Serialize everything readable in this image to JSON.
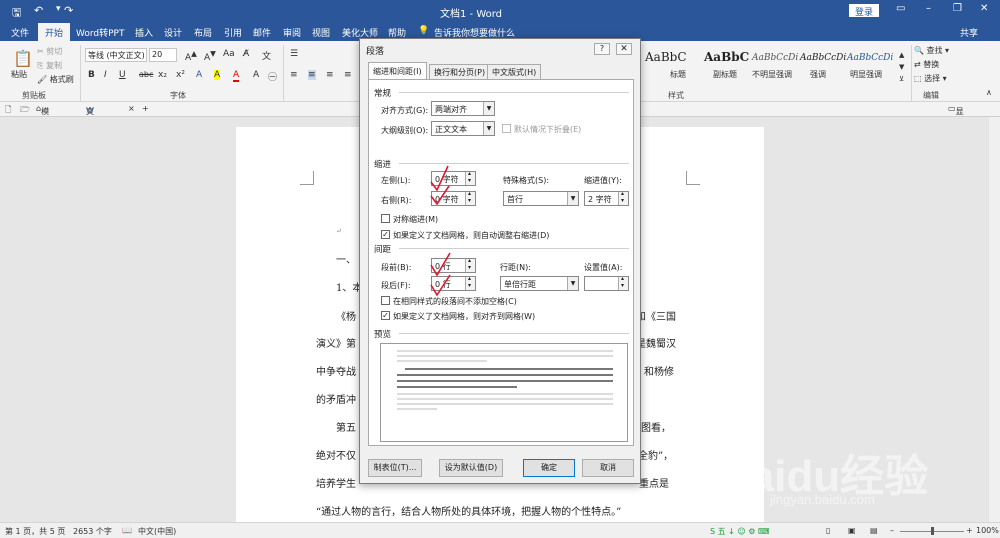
{
  "titlebar": {
    "title": "文档1 - Word",
    "login": "登录",
    "quick_access": [
      "save-icon",
      "undo-icon",
      "redo-icon",
      "customize-icon"
    ]
  },
  "tabs": [
    {
      "label": "文件"
    },
    {
      "label": "开始"
    },
    {
      "label": "Word转PPT"
    },
    {
      "label": "插入"
    },
    {
      "label": "设计"
    },
    {
      "label": "布局"
    },
    {
      "label": "引用"
    },
    {
      "label": "邮件"
    },
    {
      "label": "审阅"
    },
    {
      "label": "视图"
    },
    {
      "label": "美化大师"
    },
    {
      "label": "帮助"
    },
    {
      "label": "告诉我你想要做什么"
    }
  ],
  "share": "共享",
  "ribbon": {
    "clipboard": {
      "paste": "粘贴",
      "cut": "剪切",
      "copy": "复制",
      "format_painter": "格式刷",
      "label": "剪贴板"
    },
    "font": {
      "name": "等线 (中文正文)",
      "size": "20",
      "label": "字体",
      "buttons": [
        "B",
        "I",
        "U",
        "abc",
        "x₂",
        "x²",
        "A",
        "A",
        "A"
      ]
    },
    "styles": {
      "samples": [
        {
          "sample": "AaBbC",
          "name": "标题"
        },
        {
          "sample": "AaBbC",
          "name": "副标题"
        },
        {
          "sample": "AaBbCcDi",
          "name": "不明显强调"
        },
        {
          "sample": "AaBbCcDi",
          "name": "强调"
        },
        {
          "sample": "AaBbCcDi",
          "name": "明显强调"
        }
      ],
      "label": "样式"
    },
    "editing": {
      "find": "查找",
      "replace": "替换",
      "select": "选择",
      "label": "编辑"
    }
  },
  "doc_tabs": {
    "template": "模板专区",
    "doc": "文档1",
    "show_multi": "显示多窗口"
  },
  "document": {
    "lines": [
      "一、",
      "1、本",
      "《杨",
      "演义》第",
      "中争夺战",
      "的矛盾冲",
      "第五",
      "绝对不仅",
      "培养学生",
      "“通过人物的言行，结合人物所处的具体环境，把握人物的个性特点。”"
    ],
    "right_fragments": [
      "和《三国",
      "是魏蜀汉",
      "和杨修",
      "精意图看，",
      "周全豹”，",
      "重点是"
    ]
  },
  "dialog": {
    "title": "段落",
    "tabs": [
      "缩进和间距(I)",
      "换行和分页(P)",
      "中文版式(H)"
    ],
    "general": {
      "heading": "常规",
      "alignment_label": "对齐方式(G):",
      "alignment_value": "两端对齐",
      "outline_label": "大纲级别(O):",
      "outline_value": "正文文本",
      "collapse_label": "默认情况下折叠(E)"
    },
    "indent": {
      "heading": "缩进",
      "left_label": "左侧(L):",
      "left_value": "0 字符",
      "right_label": "右侧(R):",
      "right_value": "0 字符",
      "special_label": "特殊格式(S):",
      "special_value": "首行",
      "by_label": "缩进值(Y):",
      "by_value": "2 字符",
      "mirror_label": "对称缩进(M)",
      "autoadjust_label": "如果定义了文档网格，则自动调整右缩进(D)",
      "mirror_checked": false,
      "autoadjust_checked": true
    },
    "spacing": {
      "heading": "间距",
      "before_label": "段前(B):",
      "before_value": "0 行",
      "after_label": "段后(F):",
      "after_value": "0 行",
      "line_label": "行距(N):",
      "line_value": "单倍行距",
      "at_label": "设置值(A):",
      "at_value": "",
      "nospace_label": "在相同样式的段落间不添加空格(C)",
      "snap_label": "如果定义了文档网格，则对齐到网格(W)",
      "nospace_checked": false,
      "snap_checked": true
    },
    "preview": {
      "heading": "预览"
    },
    "buttons": {
      "tabs": "制表位(T)...",
      "default": "设为默认值(D)",
      "ok": "确定",
      "cancel": "取消"
    }
  },
  "statusbar": {
    "page": "第 1 页，共 5 页",
    "words": "2653 个字",
    "lang": "中文(中国)",
    "zoom": "100%"
  },
  "watermark": {
    "brand": "Baidu经验",
    "url": "jingyan.baidu.com"
  }
}
